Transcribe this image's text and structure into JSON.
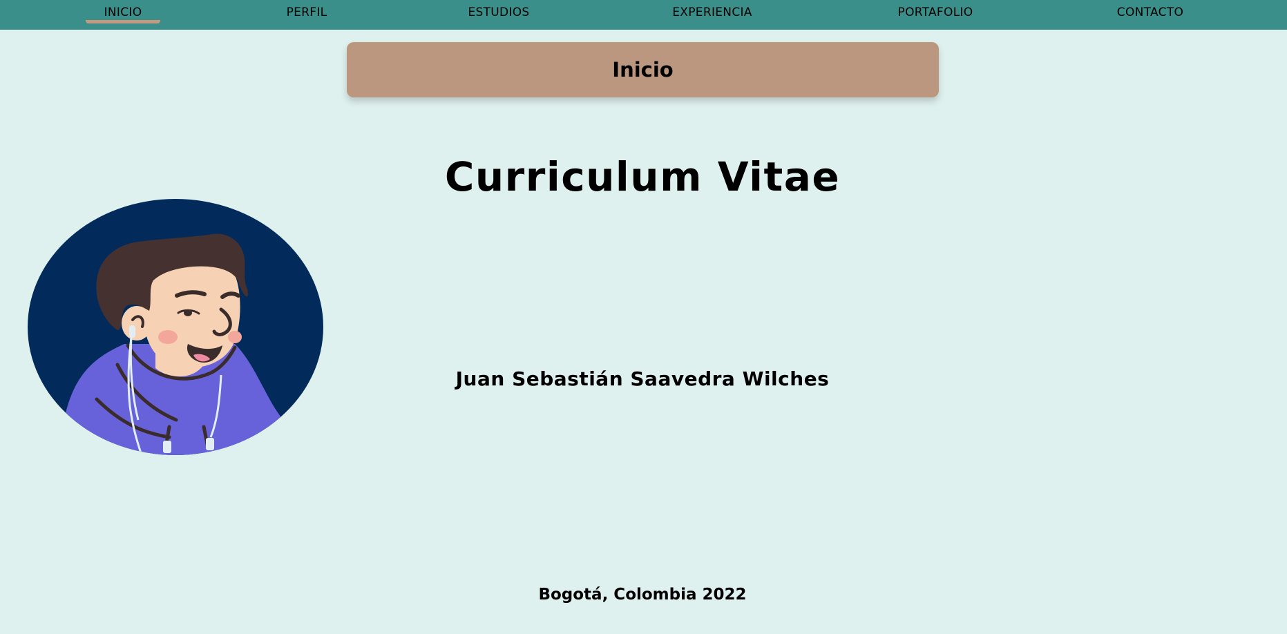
{
  "nav": {
    "items": [
      {
        "label": "INICIO",
        "active": true
      },
      {
        "label": "PERFIL",
        "active": false
      },
      {
        "label": "ESTUDIOS",
        "active": false
      },
      {
        "label": "EXPERIENCIA",
        "active": false
      },
      {
        "label": "PORTAFOLIO",
        "active": false
      },
      {
        "label": "CONTACTO",
        "active": false
      }
    ]
  },
  "section": {
    "title": "Inicio"
  },
  "main": {
    "title": "Curriculum Vitae",
    "name": "Juan Sebastián Saavedra Wilches",
    "avatar_icon": "avatar-illustration"
  },
  "footer": {
    "text": "Bogotá, Colombia 2022"
  },
  "colors": {
    "navbar": "#3a8f8a",
    "background": "#dff1ee",
    "banner": "#bb977f",
    "active_underline": "#c39a80",
    "avatar_background": "#022b5c",
    "hoodie": "#6762d9"
  }
}
